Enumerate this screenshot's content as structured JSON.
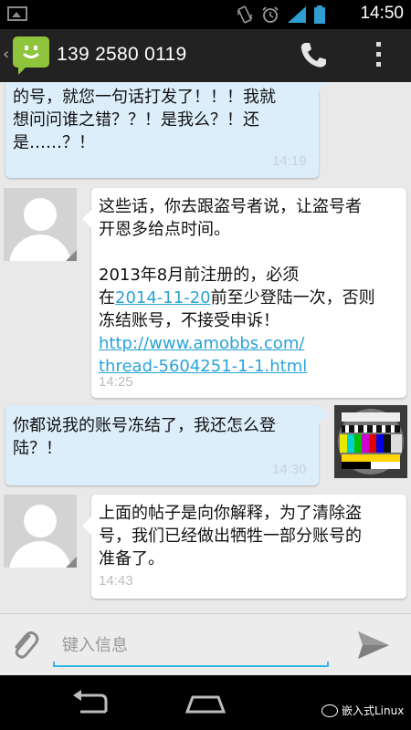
{
  "status_bar": {
    "time": "14:50",
    "icons": [
      "image-notification-icon",
      "vibrate-icon",
      "alarm-icon",
      "signal-icon",
      "battery-icon"
    ]
  },
  "action_bar": {
    "contact": "139 2580 0119",
    "icons": [
      "messaging-app-icon",
      "phone-icon",
      "overflow-menu-icon"
    ]
  },
  "messages": [
    {
      "direction": "outgoing",
      "text": "的号，就您一句话打发了！！！我就\n想问问谁之错？？！是我么？！还\n是……？！",
      "time": "14:19"
    },
    {
      "direction": "incoming",
      "avatar": "default-contact-avatar",
      "text_before_date": "这些话，你去跟盗号者说，让盗号者\n开恩多给点时间。\n\n2013年8月前注册的，必须\n在",
      "date_link": "2014-11-20",
      "text_after_date": "前至少登陆一次，否则\n冻结账号，不接受申诉！\n",
      "url": "http://www.amobbs.com/\nthread-5604251-1-1.html",
      "time": "14:25"
    },
    {
      "direction": "outgoing",
      "avatar": "test-pattern-avatar",
      "text": "你都说我的账号冻结了，我还怎么登\n陆？！",
      "time": "14:30"
    },
    {
      "direction": "incoming",
      "avatar": "default-contact-avatar",
      "text": "上面的帖子是向你解释，为了清除盗\n号，我们已经做出牺牲一部分账号的\n准备了。",
      "time": "14:43"
    }
  ],
  "compose": {
    "placeholder": "键入信息",
    "value": ""
  },
  "watermark": "嵌入式Linux",
  "colors": {
    "accent": "#33b5e5",
    "outgoing_bubble": "#ddeefb",
    "incoming_bubble": "#ffffff",
    "link": "#2aa3d8",
    "app_icon": "#8fc43d"
  }
}
